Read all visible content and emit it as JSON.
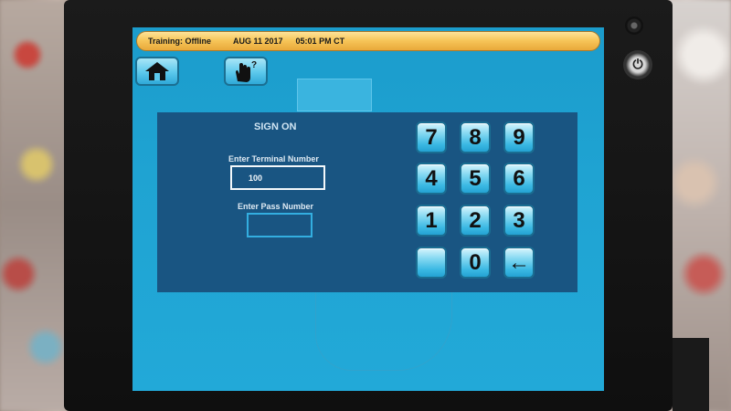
{
  "status_bar": {
    "mode": "Training: Offline",
    "date": "AUG 11 2017",
    "time": "05:01 PM CT"
  },
  "toolbar": {
    "home_icon": "home-icon",
    "help_icon": "touch-help-icon"
  },
  "sign_on": {
    "title": "SIGN ON",
    "terminal_label": "Enter Terminal Number",
    "terminal_value": "100",
    "pass_label": "Enter Pass Number",
    "pass_value": ""
  },
  "keypad": {
    "keys": [
      "7",
      "8",
      "9",
      "4",
      "5",
      "6",
      "1",
      "2",
      "3",
      "",
      "0",
      "←"
    ]
  },
  "colors": {
    "screen": "#1fa3d2",
    "panel": "#195582",
    "status_bar": "#f7c65a"
  }
}
